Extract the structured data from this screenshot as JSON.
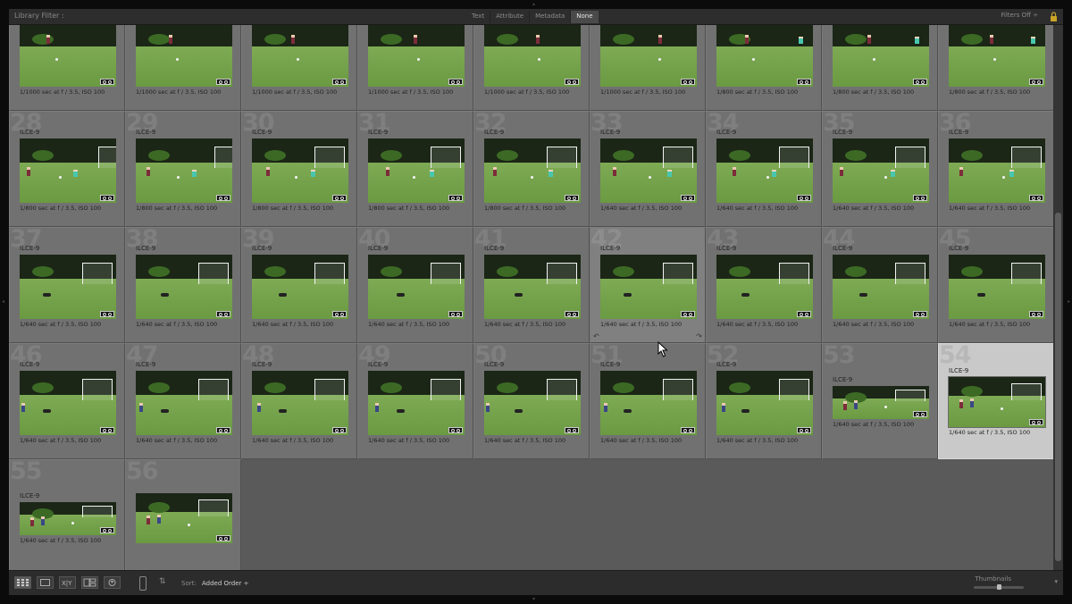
{
  "filter_bar": {
    "title": "Library Filter :",
    "tabs": [
      {
        "label": "Text",
        "active": false
      },
      {
        "label": "Attribute",
        "active": false
      },
      {
        "label": "Metadata",
        "active": false
      },
      {
        "label": "None",
        "active": true
      }
    ],
    "filters_off": "Filters Off ÷"
  },
  "grid": {
    "camera": "ILCE-9",
    "rows": [
      [
        {
          "num": "",
          "exif": "1/1000 sec at f / 3.5, ISO 100",
          "scene": "field"
        },
        {
          "num": "",
          "exif": "1/1000 sec at f / 3.5, ISO 100",
          "scene": "field"
        },
        {
          "num": "",
          "exif": "1/1000 sec at f / 3.5, ISO 100",
          "scene": "field"
        },
        {
          "num": "",
          "exif": "1/1000 sec at f / 3.5, ISO 100",
          "scene": "field"
        },
        {
          "num": "",
          "exif": "1/1000 sec at f / 3.5, ISO 100",
          "scene": "field"
        },
        {
          "num": "",
          "exif": "1/1000 sec at f / 3.5, ISO 100",
          "scene": "field"
        },
        {
          "num": "",
          "exif": "1/800 sec at f / 3.5, ISO 100",
          "scene": "field"
        },
        {
          "num": "",
          "exif": "1/800 sec at f / 3.5, ISO 100",
          "scene": "field"
        },
        {
          "num": "",
          "exif": "1/800 sec at f / 3.5, ISO 100",
          "scene": "field"
        }
      ],
      [
        {
          "num": "28",
          "exif": "1/800 sec at f / 3.5, ISO 100",
          "scene": "shot"
        },
        {
          "num": "29",
          "exif": "1/800 sec at f / 3.5, ISO 100",
          "scene": "shot"
        },
        {
          "num": "30",
          "exif": "1/800 sec at f / 3.5, ISO 100",
          "scene": "shot-goal"
        },
        {
          "num": "31",
          "exif": "1/800 sec at f / 3.5, ISO 100",
          "scene": "shot-goal"
        },
        {
          "num": "32",
          "exif": "1/800 sec at f / 3.5, ISO 100",
          "scene": "shot-goal"
        },
        {
          "num": "33",
          "exif": "1/640 sec at f / 3.5, ISO 100",
          "scene": "shot-goal"
        },
        {
          "num": "34",
          "exif": "1/640 sec at f / 3.5, ISO 100",
          "scene": "shot-goal"
        },
        {
          "num": "35",
          "exif": "1/640 sec at f / 3.5, ISO 100",
          "scene": "shot-goal"
        },
        {
          "num": "36",
          "exif": "1/640 sec at f / 3.5, ISO 100",
          "scene": "shot-goal"
        }
      ],
      [
        {
          "num": "37",
          "exif": "1/640 sec at f / 3.5, ISO 100",
          "scene": "save"
        },
        {
          "num": "38",
          "exif": "1/640 sec at f / 3.5, ISO 100",
          "scene": "save"
        },
        {
          "num": "39",
          "exif": "1/640 sec at f / 3.5, ISO 100",
          "scene": "save"
        },
        {
          "num": "40",
          "exif": "1/640 sec at f / 3.5, ISO 100",
          "scene": "save"
        },
        {
          "num": "41",
          "exif": "1/640 sec at f / 3.5, ISO 100",
          "scene": "save"
        },
        {
          "num": "42",
          "exif": "1/640 sec at f / 3.5, ISO 100",
          "scene": "save",
          "hover": true
        },
        {
          "num": "43",
          "exif": "1/640 sec at f / 3.5, ISO 100",
          "scene": "save"
        },
        {
          "num": "44",
          "exif": "1/640 sec at f / 3.5, ISO 100",
          "scene": "save"
        },
        {
          "num": "45",
          "exif": "1/640 sec at f / 3.5, ISO 100",
          "scene": "save"
        }
      ],
      [
        {
          "num": "46",
          "exif": "1/640 sec at f / 3.5, ISO 100",
          "scene": "after"
        },
        {
          "num": "47",
          "exif": "1/640 sec at f / 3.5, ISO 100",
          "scene": "after"
        },
        {
          "num": "48",
          "exif": "1/640 sec at f / 3.5, ISO 100",
          "scene": "after"
        },
        {
          "num": "49",
          "exif": "1/640 sec at f / 3.5, ISO 100",
          "scene": "after"
        },
        {
          "num": "50",
          "exif": "1/640 sec at f / 3.5, ISO 100",
          "scene": "after"
        },
        {
          "num": "51",
          "exif": "1/640 sec at f / 3.5, ISO 100",
          "scene": "after"
        },
        {
          "num": "52",
          "exif": "1/640 sec at f / 3.5, ISO 100",
          "scene": "after"
        },
        {
          "num": "53",
          "exif": "1/640 sec at f / 3.5, ISO 100",
          "scene": "wide"
        },
        {
          "num": "54",
          "exif": "1/640 sec at f / 3.5, ISO 100",
          "scene": "run",
          "selected": true
        }
      ],
      [
        {
          "num": "55",
          "exif": "1/640 sec at f / 3.5, ISO 100",
          "scene": "wide"
        },
        {
          "num": "56",
          "exif": "",
          "scene": "run-nometa"
        }
      ]
    ]
  },
  "toolbar": {
    "sort_label": "Sort:",
    "sort_value": "Added Order ÷",
    "thumbnails_label": "Thumbnails",
    "thumbnail_size": 0.5,
    "menu": "▾"
  },
  "icons": {
    "lock": "lock-icon",
    "grid_view": "grid-view-icon",
    "loupe_view": "loupe-view-icon",
    "compare_view": "compare-view-icon",
    "survey_view": "survey-view-icon",
    "people_view": "people-view-icon",
    "painter": "painter-icon",
    "sort_direction": "sort-direction-icon"
  },
  "colors": {
    "grid_bg": "#5a5a5a",
    "cell_bg": "#717171",
    "cell_selected": "#c9c9c9",
    "toolbar_bg": "#2c2c2c"
  }
}
